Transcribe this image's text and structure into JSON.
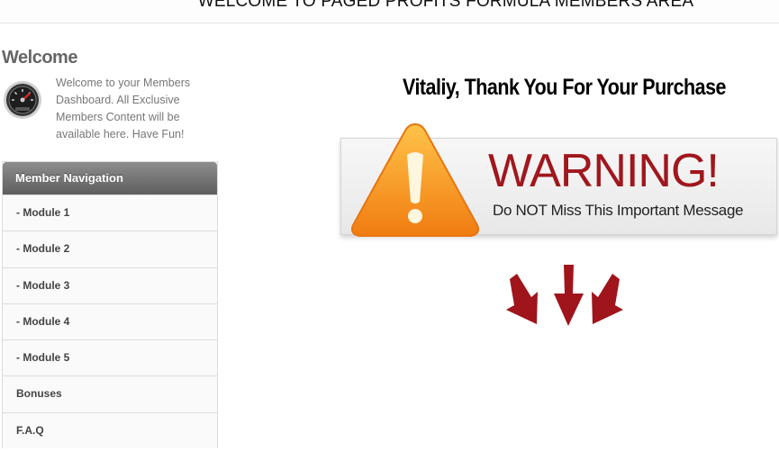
{
  "header": {
    "title": "WELCOME TO PAGED PROFITS FORMULA MEMBERS AREA"
  },
  "sidebar": {
    "welcome_title": "Welcome",
    "welcome_icon": "speedometer-icon",
    "welcome_text": "Welcome to your Members Dashboard. All Exclusive Members Content will be available here. Have Fun!",
    "nav_title": "Member Navigation",
    "nav_items": [
      {
        "label": "- Module 1"
      },
      {
        "label": "- Module 2"
      },
      {
        "label": "- Module 3"
      },
      {
        "label": "- Module 4"
      },
      {
        "label": "- Module 5"
      },
      {
        "label": "Bonuses"
      },
      {
        "label": "F.A.Q"
      }
    ]
  },
  "main": {
    "heading": "Vitaliy, Thank You For Your Purchase",
    "warning": {
      "title": "WARNING!",
      "subtitle": "Do NOT Miss This Important Message",
      "icon": "warning-triangle-icon"
    },
    "arrows_icon": "down-arrows-icon"
  },
  "colors": {
    "warning_red": "#a0171d",
    "triangle_orange": "#f7941d",
    "nav_header": "#6f6f6f"
  }
}
